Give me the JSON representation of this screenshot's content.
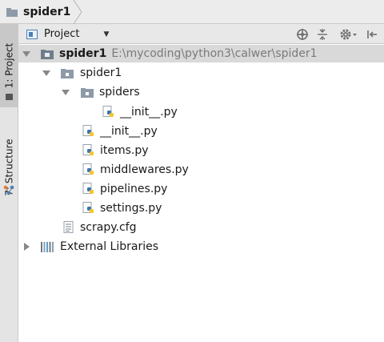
{
  "breadcrumb": {
    "label": "spider1"
  },
  "side_tabs": {
    "project": "1: Project",
    "structure": "7: Structure"
  },
  "toolbar": {
    "view_label": "Project"
  },
  "tree": {
    "root": {
      "name": "spider1",
      "path": "E:\\mycoding\\python3\\calwer\\spider1"
    },
    "pkg": {
      "name": "spider1"
    },
    "spiders": {
      "name": "spiders"
    },
    "spiders_init": {
      "name": "__init__.py"
    },
    "pkg_init": {
      "name": "__init__.py"
    },
    "items": {
      "name": "items.py"
    },
    "middlewares": {
      "name": "middlewares.py"
    },
    "pipelines": {
      "name": "pipelines.py"
    },
    "settings": {
      "name": "settings.py"
    },
    "scrapy_cfg": {
      "name": "scrapy.cfg"
    },
    "external": {
      "name": "External Libraries"
    }
  }
}
